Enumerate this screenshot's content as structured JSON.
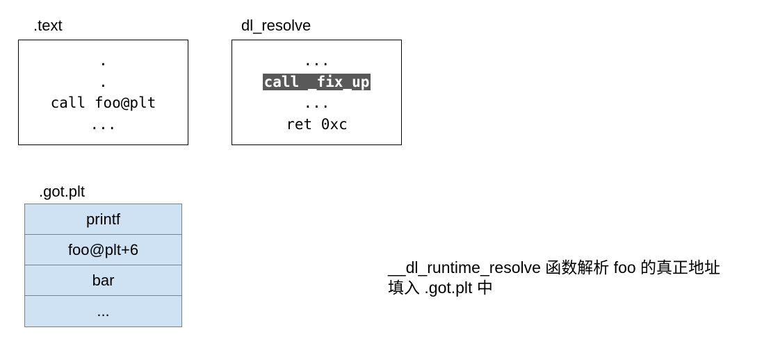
{
  "text_section": {
    "label": ".text",
    "lines": [
      ".",
      ".",
      "call foo@plt",
      "..."
    ]
  },
  "dl_resolve": {
    "label": "dl_resolve",
    "lines": [
      "...",
      "call _fix_up",
      "...",
      "ret 0xc"
    ],
    "highlight_color": "#595959"
  },
  "got_plt": {
    "label": ".got.plt",
    "fill_color": "#cfe2f3",
    "rows": [
      "printf",
      "foo@plt+6",
      "bar",
      "..."
    ]
  },
  "note": {
    "line1": "__dl_runtime_resolve 函数解析 foo 的真正地址",
    "line2": "填入 .got.plt 中"
  }
}
